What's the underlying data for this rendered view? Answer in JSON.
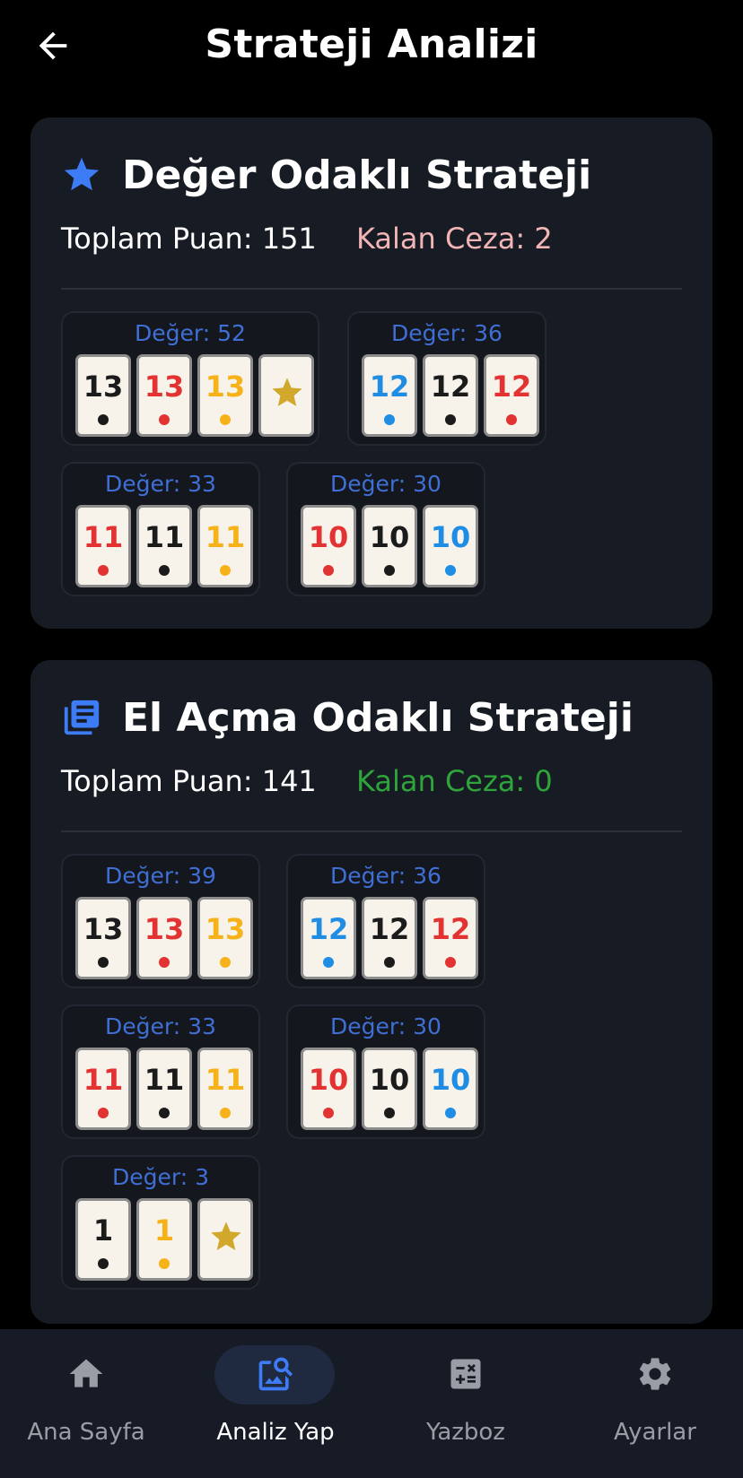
{
  "header": {
    "title": "Strateji Analizi",
    "back_icon": "arrow-left-icon"
  },
  "colors": {
    "accent": "#3d7cf5",
    "tile_black": "#1b1b1b",
    "tile_red": "#e23232",
    "tile_yellow": "#f7b21a",
    "tile_blue": "#1f8de4",
    "joker": "#d1a82c",
    "penalty_positive": "#f2b5b5",
    "penalty_zero": "#2fa43a"
  },
  "strategies": [
    {
      "icon": "star-icon",
      "title": "Değer Odaklı Strateji",
      "total_label": "Toplam Puan: 151",
      "penalty_label": "Kalan Ceza: 2",
      "groups": [
        {
          "label": "Değer: 52",
          "tiles": [
            {
              "num": "13",
              "color": "black"
            },
            {
              "num": "13",
              "color": "red"
            },
            {
              "num": "13",
              "color": "yellow"
            },
            {
              "num": "",
              "color": "joker"
            }
          ]
        },
        {
          "label": "Değer: 36",
          "tiles": [
            {
              "num": "12",
              "color": "blue"
            },
            {
              "num": "12",
              "color": "black"
            },
            {
              "num": "12",
              "color": "red"
            }
          ]
        },
        {
          "label": "Değer: 33",
          "tiles": [
            {
              "num": "11",
              "color": "red"
            },
            {
              "num": "11",
              "color": "black"
            },
            {
              "num": "11",
              "color": "yellow"
            }
          ]
        },
        {
          "label": "Değer: 30",
          "tiles": [
            {
              "num": "10",
              "color": "red"
            },
            {
              "num": "10",
              "color": "black"
            },
            {
              "num": "10",
              "color": "blue"
            }
          ]
        }
      ]
    },
    {
      "icon": "library-books-icon",
      "title": "El Açma Odaklı Strateji",
      "total_label": "Toplam Puan: 141",
      "penalty_label": "Kalan Ceza: 0",
      "groups": [
        {
          "label": "Değer: 39",
          "tiles": [
            {
              "num": "13",
              "color": "black"
            },
            {
              "num": "13",
              "color": "red"
            },
            {
              "num": "13",
              "color": "yellow"
            }
          ]
        },
        {
          "label": "Değer: 36",
          "tiles": [
            {
              "num": "12",
              "color": "blue"
            },
            {
              "num": "12",
              "color": "black"
            },
            {
              "num": "12",
              "color": "red"
            }
          ]
        },
        {
          "label": "Değer: 33",
          "tiles": [
            {
              "num": "11",
              "color": "red"
            },
            {
              "num": "11",
              "color": "black"
            },
            {
              "num": "11",
              "color": "yellow"
            }
          ]
        },
        {
          "label": "Değer: 30",
          "tiles": [
            {
              "num": "10",
              "color": "red"
            },
            {
              "num": "10",
              "color": "black"
            },
            {
              "num": "10",
              "color": "blue"
            }
          ]
        },
        {
          "label": "Değer: 3",
          "tiles": [
            {
              "num": "1",
              "color": "black"
            },
            {
              "num": "1",
              "color": "yellow"
            },
            {
              "num": "",
              "color": "joker"
            }
          ]
        }
      ]
    }
  ],
  "bottom_nav": [
    {
      "label": "Ana Sayfa",
      "icon": "home-icon",
      "active": false
    },
    {
      "label": "Analiz Yap",
      "icon": "image-search-icon",
      "active": true
    },
    {
      "label": "Yazboz",
      "icon": "calculator-icon",
      "active": false
    },
    {
      "label": "Ayarlar",
      "icon": "gear-icon",
      "active": false
    }
  ]
}
